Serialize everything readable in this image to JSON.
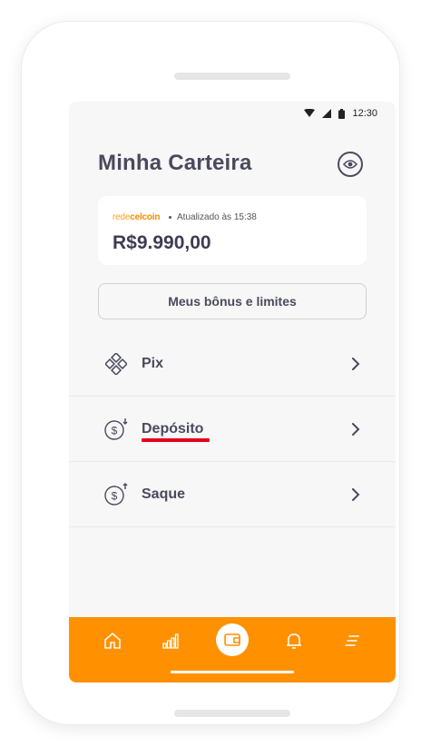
{
  "status_bar": {
    "time": "12:30"
  },
  "header": {
    "title": "Minha Carteira"
  },
  "balance_card": {
    "brand_prefix": "rede",
    "brand_name": "celcoin",
    "updated_text": "Atualizado às 15:38",
    "balance": "R$9.990,00"
  },
  "bonus_button": {
    "label": "Meus bônus e limites"
  },
  "menu": {
    "items": [
      {
        "label": "Pix",
        "icon": "pix-icon"
      },
      {
        "label": "Depósito",
        "icon": "dollar-coin-down-icon"
      },
      {
        "label": "Saque",
        "icon": "dollar-coin-up-icon"
      }
    ]
  },
  "bottom_nav": {
    "items": [
      "home-icon",
      "chart-icon",
      "wallet-icon",
      "bell-icon",
      "menu-icon"
    ],
    "active": "wallet-icon"
  },
  "colors": {
    "accent": "#ff9100",
    "text": "#4a4a5e",
    "underline": "#e5001b",
    "background": "#f7f7f7"
  }
}
